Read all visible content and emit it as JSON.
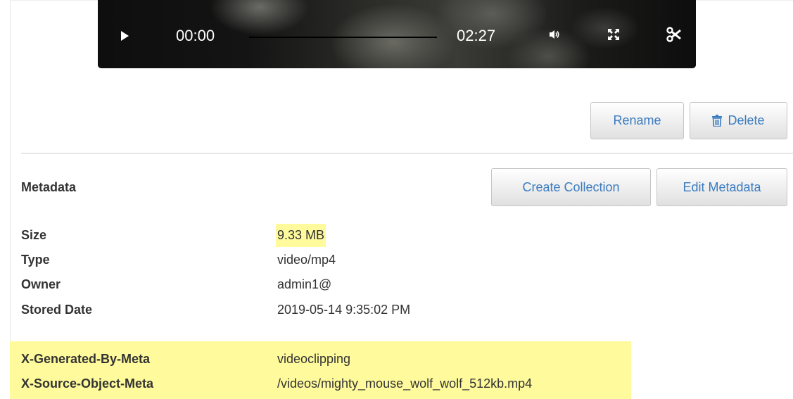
{
  "player": {
    "current_time": "00:00",
    "total_time": "02:27",
    "progress": 0.0,
    "icons": [
      "play-icon",
      "volume-icon",
      "fullscreen-icon",
      "scissors-icon"
    ]
  },
  "actions": {
    "rename_label": "Rename",
    "delete_label": "Delete",
    "create_collection_label": "Create Collection",
    "edit_metadata_label": "Edit Metadata"
  },
  "metadata": {
    "title": "Metadata",
    "rows": [
      {
        "label": "Size",
        "value": "9.33 MB"
      },
      {
        "label": "Type",
        "value": "video/mp4"
      },
      {
        "label": "Owner",
        "value": "admin1@"
      },
      {
        "label": "Stored Date",
        "value": "2019-05-14 9:35:02 PM"
      }
    ],
    "custom_rows": [
      {
        "label": "X-Generated-By-Meta",
        "value": "videoclipping"
      },
      {
        "label": "X-Source-Object-Meta",
        "value": "/videos/mighty_mouse_wolf_wolf_512kb.mp4"
      }
    ]
  },
  "colors": {
    "highlight": "#fffb9c",
    "link_blue": "#3a7bbf",
    "player_bg": "#141414"
  }
}
